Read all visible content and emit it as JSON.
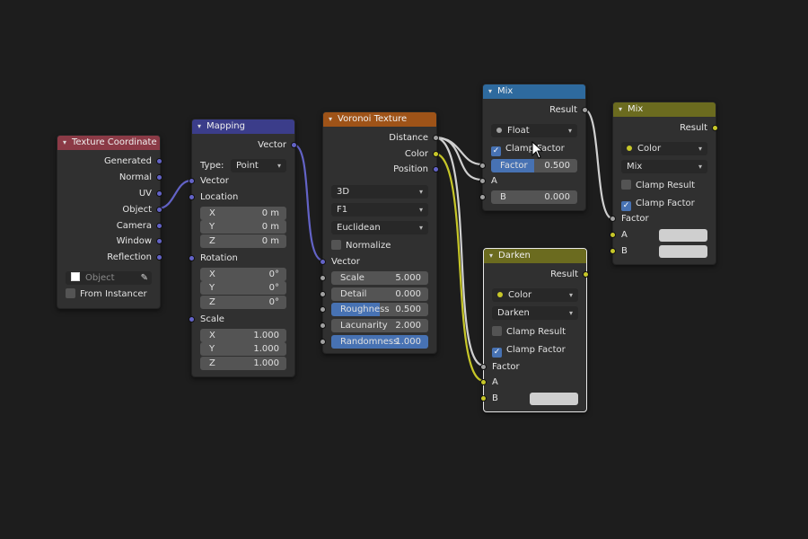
{
  "nodes": {
    "texcoord": {
      "title": "Texture Coordinate",
      "color": "#8b3a46",
      "outputs": [
        "Generated",
        "Normal",
        "UV",
        "Object",
        "Camera",
        "Window",
        "Reflection"
      ],
      "object_placeholder": "Object",
      "from_instancer": "From Instancer"
    },
    "mapping": {
      "title": "Mapping",
      "color": "#3b3d8a",
      "output": "Vector",
      "type_label": "Type:",
      "type_value": "Point",
      "vector": "Vector",
      "location": "Location",
      "location_values": [
        {
          "axis": "X",
          "value": "0 m"
        },
        {
          "axis": "Y",
          "value": "0 m"
        },
        {
          "axis": "Z",
          "value": "0 m"
        }
      ],
      "rotation": "Rotation",
      "rotation_values": [
        {
          "axis": "X",
          "value": "0°"
        },
        {
          "axis": "Y",
          "value": "0°"
        },
        {
          "axis": "Z",
          "value": "0°"
        }
      ],
      "scale": "Scale",
      "scale_values": [
        {
          "axis": "X",
          "value": "1.000"
        },
        {
          "axis": "Y",
          "value": "1.000"
        },
        {
          "axis": "Z",
          "value": "1.000"
        }
      ]
    },
    "voronoi": {
      "title": "Voronoi Texture",
      "color": "#9e5318",
      "outputs": [
        "Distance",
        "Color",
        "Position"
      ],
      "dims": "3D",
      "feature": "F1",
      "metric": "Euclidean",
      "normalize": "Normalize",
      "vector": "Vector",
      "params": [
        {
          "label": "Scale",
          "value": "5.000"
        },
        {
          "label": "Detail",
          "value": "0.000"
        },
        {
          "label": "Roughness",
          "value": "0.500"
        },
        {
          "label": "Lacunarity",
          "value": "2.000"
        },
        {
          "label": "Randomness",
          "value": "1.000"
        }
      ]
    },
    "mix1": {
      "title": "Mix",
      "color": "#2e6a9e",
      "output": "Result",
      "data_type": "Float",
      "clamp_factor": "Clamp Factor",
      "factor_label": "Factor",
      "factor_value": "0.500",
      "a": "A",
      "b": "B",
      "b_value": "0.000"
    },
    "darken": {
      "title": "Darken",
      "color": "#6b6b1f",
      "output": "Result",
      "data_type": "Color",
      "blend": "Darken",
      "clamp_result": "Clamp Result",
      "clamp_factor": "Clamp Factor",
      "factor": "Factor",
      "a": "A",
      "b": "B"
    },
    "mix2": {
      "title": "Mix",
      "color": "#6b6b1f",
      "output": "Result",
      "data_type": "Color",
      "blend": "Mix",
      "clamp_result": "Clamp Result",
      "clamp_factor": "Clamp Factor",
      "factor": "Factor",
      "a": "A",
      "b": "B"
    }
  },
  "icons": {
    "collapse": "chevron-down-icon",
    "eyedropper": "eyedropper-icon",
    "object": "object-icon",
    "cursor": "mouse-cursor-icon"
  },
  "colors": {
    "vector_socket": "#6363c7",
    "color_socket": "#c7c729",
    "float_socket": "#a1a1a1",
    "active_field": "#4772b3"
  }
}
